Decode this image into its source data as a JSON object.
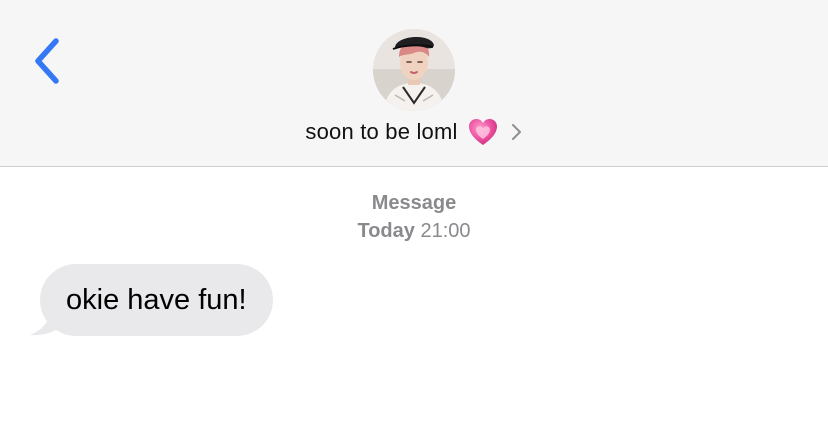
{
  "header": {
    "back_icon": "chevron-left-icon",
    "contact_name": "soon to be loml",
    "contact_emoji": "heart-icon",
    "chevron_icon": "chevron-right-icon",
    "avatar": "contact-avatar"
  },
  "thread": {
    "service": "Message",
    "timestamp_day": "Today",
    "timestamp_time": "21:00"
  },
  "messages": [
    {
      "direction": "incoming",
      "text": "okie have fun!"
    }
  ],
  "colors": {
    "accent": "#3478f6",
    "header_bg": "#f6f6f6",
    "bubble_incoming": "#e9e9eb",
    "secondary_text": "#8a8a8e",
    "heart": "#e84a9a"
  }
}
